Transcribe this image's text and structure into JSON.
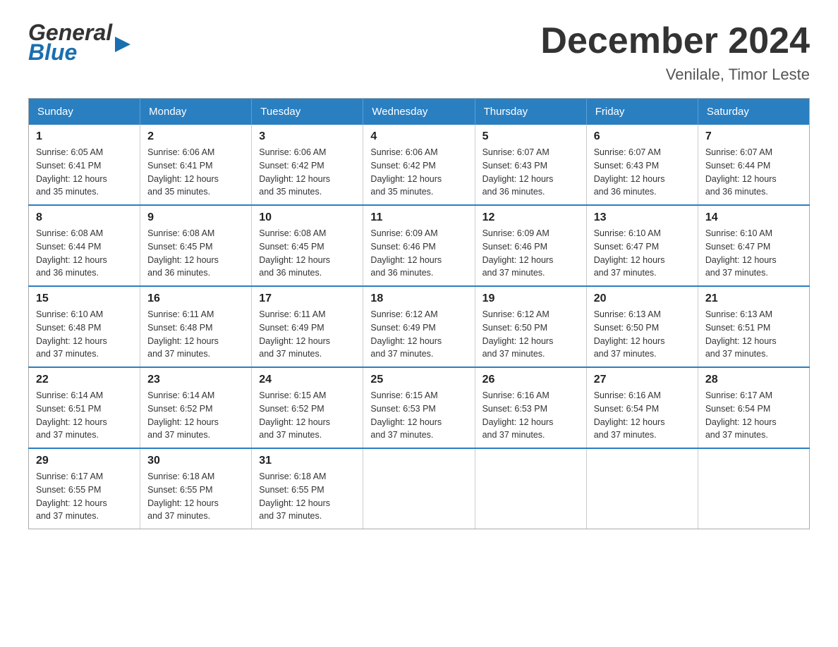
{
  "logo": {
    "general": "General",
    "blue": "Blue"
  },
  "header": {
    "title": "December 2024",
    "subtitle": "Venilale, Timor Leste"
  },
  "weekdays": [
    "Sunday",
    "Monday",
    "Tuesday",
    "Wednesday",
    "Thursday",
    "Friday",
    "Saturday"
  ],
  "weeks": [
    [
      {
        "day": "1",
        "sunrise": "6:05 AM",
        "sunset": "6:41 PM",
        "daylight": "12 hours and 35 minutes."
      },
      {
        "day": "2",
        "sunrise": "6:06 AM",
        "sunset": "6:41 PM",
        "daylight": "12 hours and 35 minutes."
      },
      {
        "day": "3",
        "sunrise": "6:06 AM",
        "sunset": "6:42 PM",
        "daylight": "12 hours and 35 minutes."
      },
      {
        "day": "4",
        "sunrise": "6:06 AM",
        "sunset": "6:42 PM",
        "daylight": "12 hours and 35 minutes."
      },
      {
        "day": "5",
        "sunrise": "6:07 AM",
        "sunset": "6:43 PM",
        "daylight": "12 hours and 36 minutes."
      },
      {
        "day": "6",
        "sunrise": "6:07 AM",
        "sunset": "6:43 PM",
        "daylight": "12 hours and 36 minutes."
      },
      {
        "day": "7",
        "sunrise": "6:07 AM",
        "sunset": "6:44 PM",
        "daylight": "12 hours and 36 minutes."
      }
    ],
    [
      {
        "day": "8",
        "sunrise": "6:08 AM",
        "sunset": "6:44 PM",
        "daylight": "12 hours and 36 minutes."
      },
      {
        "day": "9",
        "sunrise": "6:08 AM",
        "sunset": "6:45 PM",
        "daylight": "12 hours and 36 minutes."
      },
      {
        "day": "10",
        "sunrise": "6:08 AM",
        "sunset": "6:45 PM",
        "daylight": "12 hours and 36 minutes."
      },
      {
        "day": "11",
        "sunrise": "6:09 AM",
        "sunset": "6:46 PM",
        "daylight": "12 hours and 36 minutes."
      },
      {
        "day": "12",
        "sunrise": "6:09 AM",
        "sunset": "6:46 PM",
        "daylight": "12 hours and 37 minutes."
      },
      {
        "day": "13",
        "sunrise": "6:10 AM",
        "sunset": "6:47 PM",
        "daylight": "12 hours and 37 minutes."
      },
      {
        "day": "14",
        "sunrise": "6:10 AM",
        "sunset": "6:47 PM",
        "daylight": "12 hours and 37 minutes."
      }
    ],
    [
      {
        "day": "15",
        "sunrise": "6:10 AM",
        "sunset": "6:48 PM",
        "daylight": "12 hours and 37 minutes."
      },
      {
        "day": "16",
        "sunrise": "6:11 AM",
        "sunset": "6:48 PM",
        "daylight": "12 hours and 37 minutes."
      },
      {
        "day": "17",
        "sunrise": "6:11 AM",
        "sunset": "6:49 PM",
        "daylight": "12 hours and 37 minutes."
      },
      {
        "day": "18",
        "sunrise": "6:12 AM",
        "sunset": "6:49 PM",
        "daylight": "12 hours and 37 minutes."
      },
      {
        "day": "19",
        "sunrise": "6:12 AM",
        "sunset": "6:50 PM",
        "daylight": "12 hours and 37 minutes."
      },
      {
        "day": "20",
        "sunrise": "6:13 AM",
        "sunset": "6:50 PM",
        "daylight": "12 hours and 37 minutes."
      },
      {
        "day": "21",
        "sunrise": "6:13 AM",
        "sunset": "6:51 PM",
        "daylight": "12 hours and 37 minutes."
      }
    ],
    [
      {
        "day": "22",
        "sunrise": "6:14 AM",
        "sunset": "6:51 PM",
        "daylight": "12 hours and 37 minutes."
      },
      {
        "day": "23",
        "sunrise": "6:14 AM",
        "sunset": "6:52 PM",
        "daylight": "12 hours and 37 minutes."
      },
      {
        "day": "24",
        "sunrise": "6:15 AM",
        "sunset": "6:52 PM",
        "daylight": "12 hours and 37 minutes."
      },
      {
        "day": "25",
        "sunrise": "6:15 AM",
        "sunset": "6:53 PM",
        "daylight": "12 hours and 37 minutes."
      },
      {
        "day": "26",
        "sunrise": "6:16 AM",
        "sunset": "6:53 PM",
        "daylight": "12 hours and 37 minutes."
      },
      {
        "day": "27",
        "sunrise": "6:16 AM",
        "sunset": "6:54 PM",
        "daylight": "12 hours and 37 minutes."
      },
      {
        "day": "28",
        "sunrise": "6:17 AM",
        "sunset": "6:54 PM",
        "daylight": "12 hours and 37 minutes."
      }
    ],
    [
      {
        "day": "29",
        "sunrise": "6:17 AM",
        "sunset": "6:55 PM",
        "daylight": "12 hours and 37 minutes."
      },
      {
        "day": "30",
        "sunrise": "6:18 AM",
        "sunset": "6:55 PM",
        "daylight": "12 hours and 37 minutes."
      },
      {
        "day": "31",
        "sunrise": "6:18 AM",
        "sunset": "6:55 PM",
        "daylight": "12 hours and 37 minutes."
      },
      null,
      null,
      null,
      null
    ]
  ],
  "labels": {
    "sunrise": "Sunrise:",
    "sunset": "Sunset:",
    "daylight": "Daylight:"
  }
}
